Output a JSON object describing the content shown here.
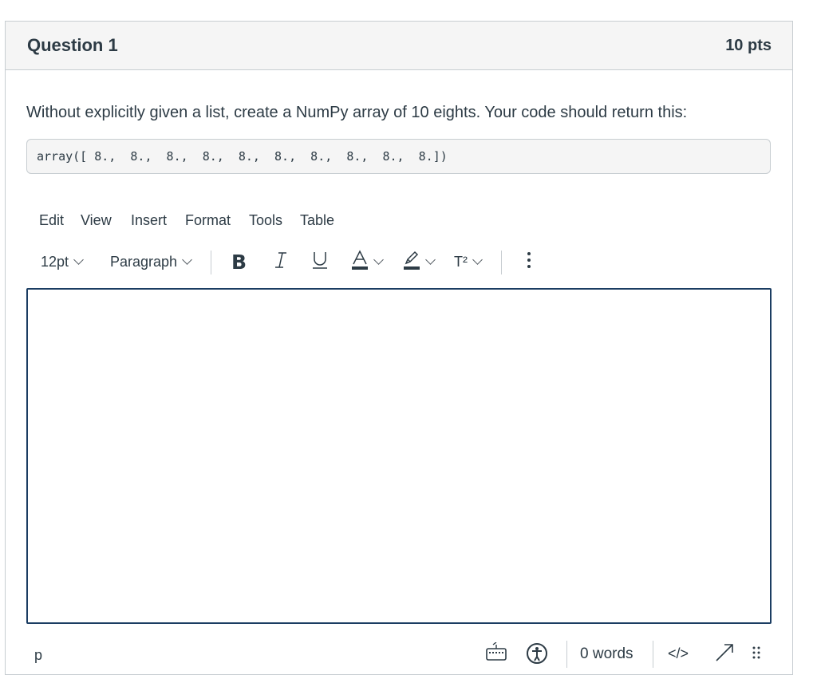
{
  "question": {
    "title": "Question 1",
    "points": "10 pts",
    "text": "Without explicitly given a list, create a NumPy array of 10 eights. Your code should return this:",
    "code": "array([ 8.,  8.,  8.,  8.,  8.,  8.,  8.,  8.,  8.,  8.])"
  },
  "editor": {
    "menu": [
      "Edit",
      "View",
      "Insert",
      "Format",
      "Tools",
      "Table"
    ],
    "toolbar": {
      "font_size": "12pt",
      "block_format": "Paragraph",
      "superscript_label": "T²",
      "text_color": "#2d3b45",
      "highlight_color": "#2d3b45"
    },
    "content": "",
    "status": {
      "path": "p",
      "word_count": "0 words",
      "html_toggle": "</>"
    }
  },
  "colors": {
    "editor_border": "#1b3d62",
    "text": "#2d3b45",
    "header_bg": "#f5f5f5"
  },
  "icons": [
    "chevron-down-icon",
    "bold-icon",
    "italic-icon",
    "underline-icon",
    "text-color-icon",
    "highlight-icon",
    "superscript-icon",
    "more-options-icon",
    "keyboard-icon",
    "accessibility-icon",
    "html-editor-icon",
    "fullscreen-icon",
    "resize-handle-icon"
  ]
}
